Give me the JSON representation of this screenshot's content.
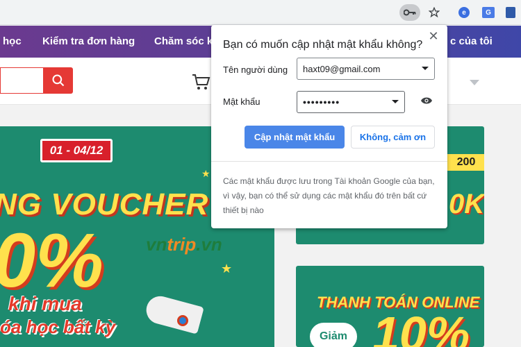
{
  "browser": {
    "toolbar_icons": [
      "key-icon",
      "star-icon",
      "extension-icon",
      "translate-icon",
      "bookmark-extension-icon"
    ]
  },
  "site": {
    "nav_items": [
      "học",
      "Kiểm tra đơn hàng",
      "Chăm sóc k",
      "c của tôi"
    ],
    "accent_color": "#e53935",
    "nav_gradient": [
      "#6b3a8f",
      "#3f47a8"
    ]
  },
  "banners": {
    "main": {
      "date": "01 - 04/12",
      "voucher": "NG VOUCHER",
      "percent": "0%",
      "khi_mua": "khi mua",
      "khoa_hoc": "óa học bất kỳ",
      "logo_main": "vn",
      "logo_accent": "trip",
      "logo_suffix": ".vn"
    },
    "side1": {
      "tag": "200",
      "amount": "0K"
    },
    "side2": {
      "title": "THANH TOÁN ONLINE",
      "percent": "10%",
      "giam": "Giảm"
    }
  },
  "dialog": {
    "title": "Bạn có muốn cập nhật mật khẩu không?",
    "username_label": "Tên người dùng",
    "username_value": "haxt09@gmail.com",
    "password_label": "Mật khẩu",
    "password_value": "•••••••••",
    "update_button": "Cập nhật mật khẩu",
    "decline_button": "Không, cảm ơn",
    "footer": "Các mật khẩu được lưu trong Tài khoản Google của bạn, vì vậy, bạn có thể sử dụng các mật khẩu đó trên bất cứ thiết bị nào",
    "primary_color": "#4a86e8"
  }
}
